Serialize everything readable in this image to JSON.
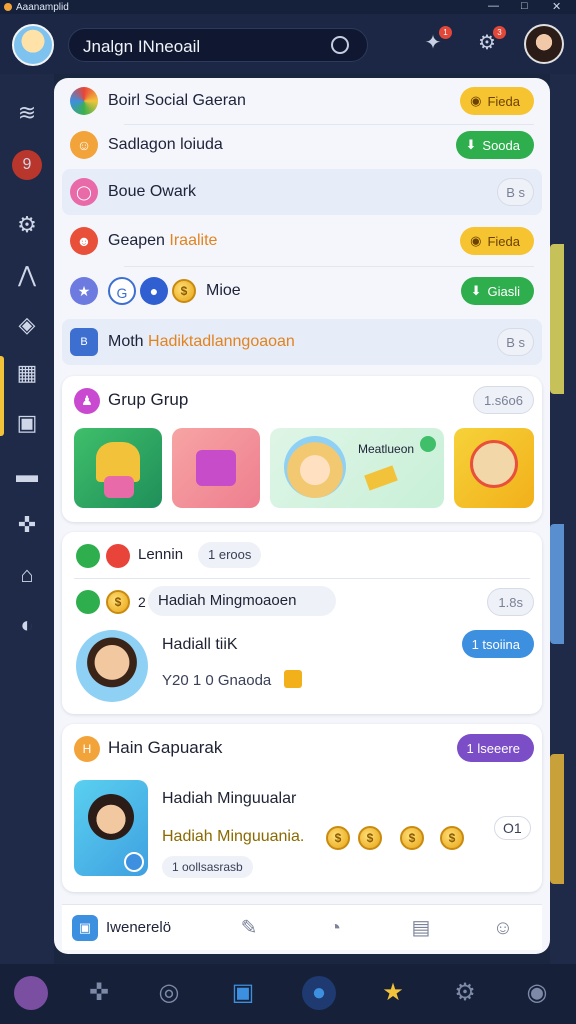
{
  "window": {
    "title": "Aaanamplid",
    "controls": [
      "—",
      "□",
      "✕"
    ]
  },
  "topbar": {
    "search_text": "Jnalgn INneoail",
    "notif_badge_1": "1",
    "notif_badge_2": "3"
  },
  "rows": [
    {
      "label": "Boirl Social Gaeran",
      "pill": "Fieda",
      "pill_style": "yellow"
    },
    {
      "label": "Sadlagon loiuda",
      "pill": "Sooda",
      "pill_style": "green"
    },
    {
      "label": "Boue Owark",
      "pill": "B s",
      "pill_style": "outline"
    },
    {
      "label_a": "Geapen ",
      "label_b": "Iraalite",
      "pill": "Fieda",
      "pill_style": "yellow"
    },
    {
      "label": "Mioe",
      "pill": "Giasli",
      "pill_style": "green"
    },
    {
      "label_a": "Moth ",
      "label_b": "Hadiktadlanngoaoan",
      "pill": "B s",
      "pill_style": "outline"
    }
  ],
  "group_card": {
    "title": "Grup Grup",
    "count": "1.s6o6",
    "featured_label": "Meatlueon"
  },
  "reward_card": {
    "row1_label": "Lennin",
    "row1_tag": "1 eroos",
    "row2_prefix": "2",
    "row2_label": "Hadiah Mingmoaoen",
    "row2_count": "1.8s",
    "profile_name": "Hadiall tiiK",
    "profile_sub": "Y20 1 0 Gnaoda",
    "profile_pill": "1 tsoiina"
  },
  "coin_card": {
    "title": "Hain Gapuarak",
    "title_pill": "1 lseeere",
    "item_title": "Hadiah Minguualar",
    "item_sub": "Hadiah Minguuania.",
    "item_tag": "1 oollsasrasb",
    "counter": "O1"
  },
  "bottom_nav": {
    "first_label": "Iwenerelö"
  },
  "colors": {
    "accent_yellow": "#f6c331",
    "accent_green": "#2fae4e",
    "accent_blue": "#3d8fe0",
    "accent_purple": "#7b4ec7",
    "dark_bg": "#1a2540"
  }
}
